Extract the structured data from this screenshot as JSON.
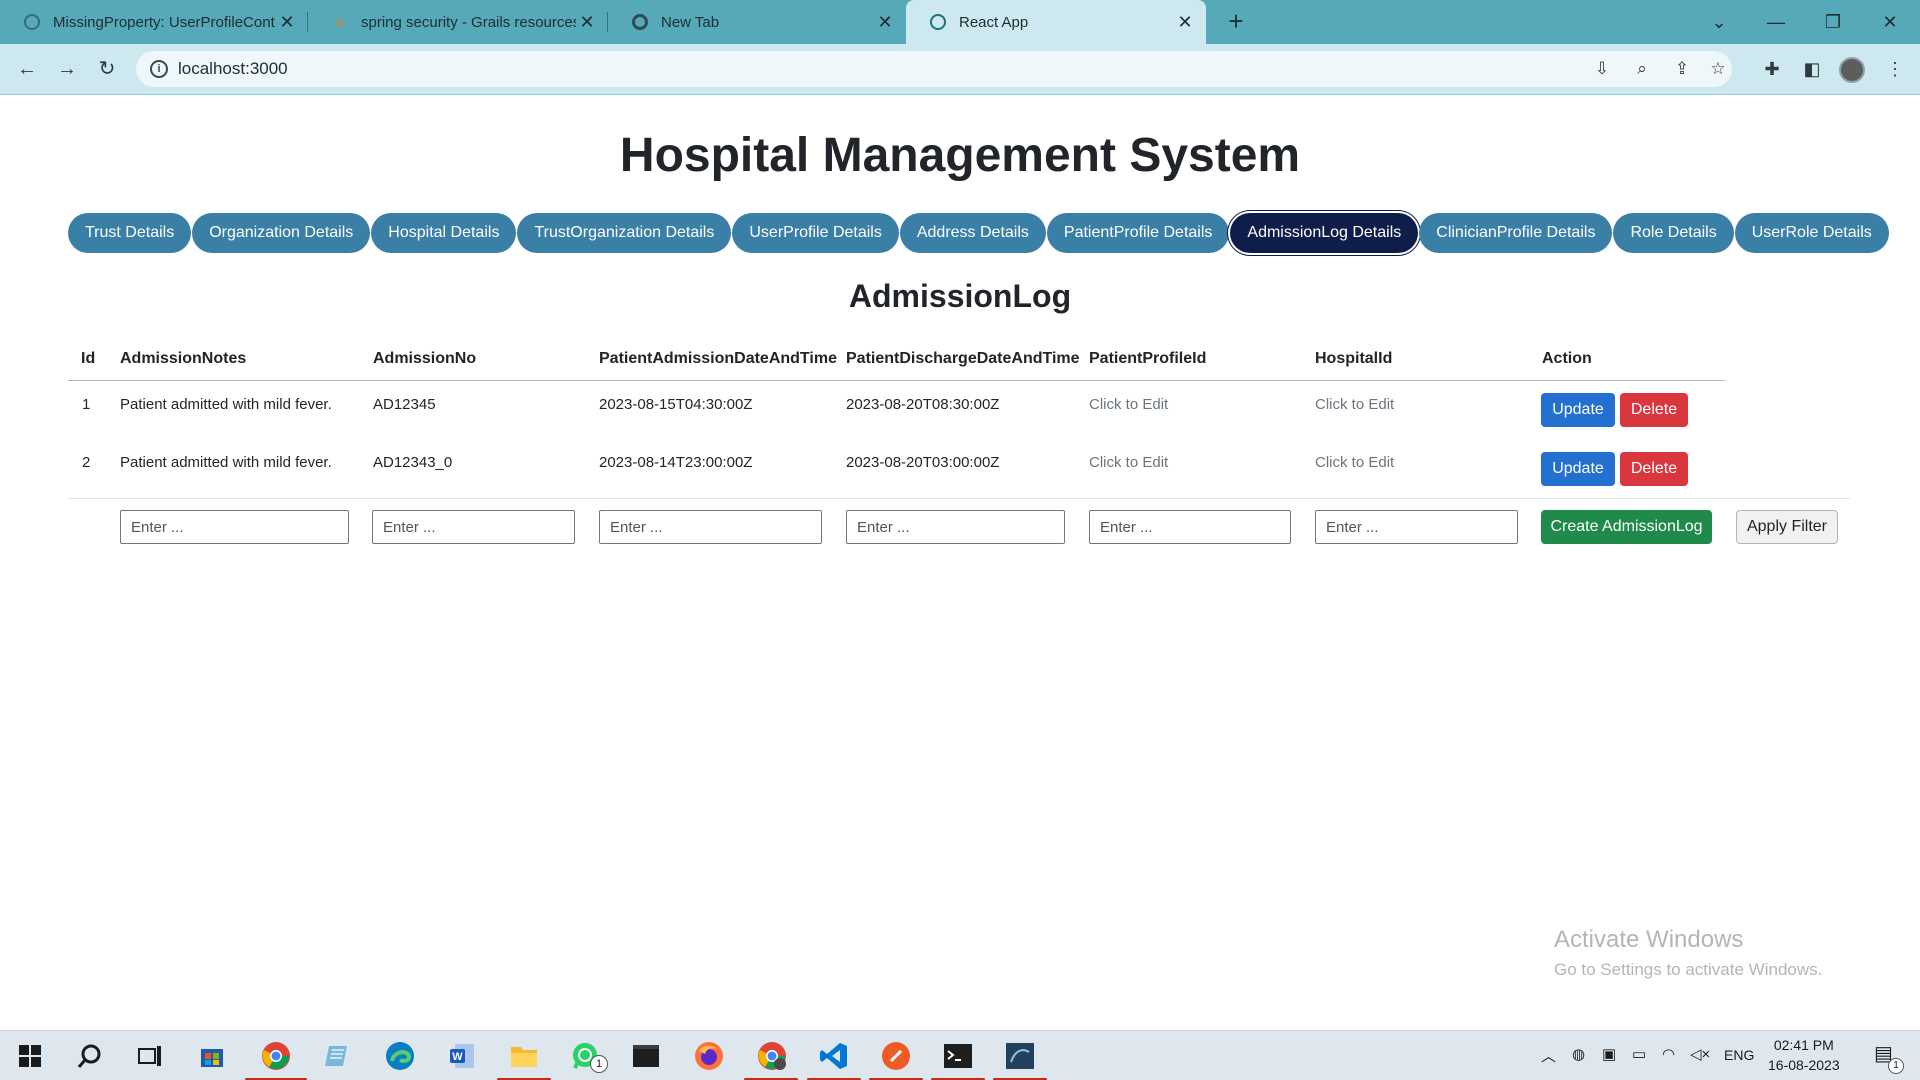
{
  "browser": {
    "tabs": [
      {
        "title": "MissingProperty: UserProfileCont",
        "favicon": "grails-icon"
      },
      {
        "title": "spring security - Grails resources",
        "favicon": "stackoverflow-icon"
      },
      {
        "title": "New Tab",
        "favicon": "chrome-icon"
      },
      {
        "title": "React App",
        "favicon": "react-icon",
        "active": true
      }
    ],
    "url": "localhost:3000"
  },
  "page": {
    "title": "Hospital Management System",
    "nav": [
      "Trust Details",
      "Organization Details",
      "Hospital Details",
      "TrustOrganization Details",
      "UserProfile Details",
      "Address Details",
      "PatientProfile Details",
      "AdmissionLog Details",
      "ClinicianProfile Details",
      "Role Details",
      "UserRole Details"
    ],
    "active_nav": "AdmissionLog Details",
    "section_title": "AdmissionLog",
    "table": {
      "headers": [
        "Id",
        "AdmissionNotes",
        "AdmissionNo",
        "PatientAdmissionDateAndTime",
        "PatientDischargeDateAndTime",
        "PatientProfileId",
        "HospitalId",
        "Action"
      ],
      "rows": [
        [
          "1",
          "Patient admitted with mild fever.",
          "AD12345",
          "2023-08-15T04:30:00Z",
          "2023-08-20T08:30:00Z",
          "Click to Edit",
          "Click to Edit"
        ],
        [
          "2",
          "Patient admitted with mild fever.",
          "AD12343_0",
          "2023-08-14T23:00:00Z",
          "2023-08-20T03:00:00Z",
          "Click to Edit",
          "Click to Edit"
        ]
      ],
      "update_label": "Update",
      "delete_label": "Delete"
    },
    "form": {
      "placeholder": "Enter ...",
      "create_label": "Create AdmissionLog",
      "filter_label": "Apply Filter"
    }
  },
  "watermark": {
    "line1": "Activate Windows",
    "line2": "Go to Settings to activate Windows."
  },
  "taskbar": {
    "apps": [
      "windows-start-icon",
      "search-icon",
      "task-view-icon",
      "store-icon",
      "chrome-icon",
      "notepad-icon",
      "edge-icon",
      "word-icon",
      "file-explorer-icon",
      "whatsapp-icon",
      "terminal-icon",
      "firefox-icon",
      "chrome-profile-icon",
      "vscode-icon",
      "postman-icon",
      "cmd-icon",
      "database-icon"
    ],
    "whatsapp_badge": "1",
    "language": "ENG",
    "time": "02:41 PM",
    "date": "16-08-2023",
    "notification_count": "1"
  },
  "colors": {
    "nav_pill": "#3a7fa6",
    "nav_active": "#0f1d4a",
    "update": "#2470d0",
    "delete": "#d9363e",
    "create": "#1f8a4a",
    "chrome": "#56a9b8"
  }
}
